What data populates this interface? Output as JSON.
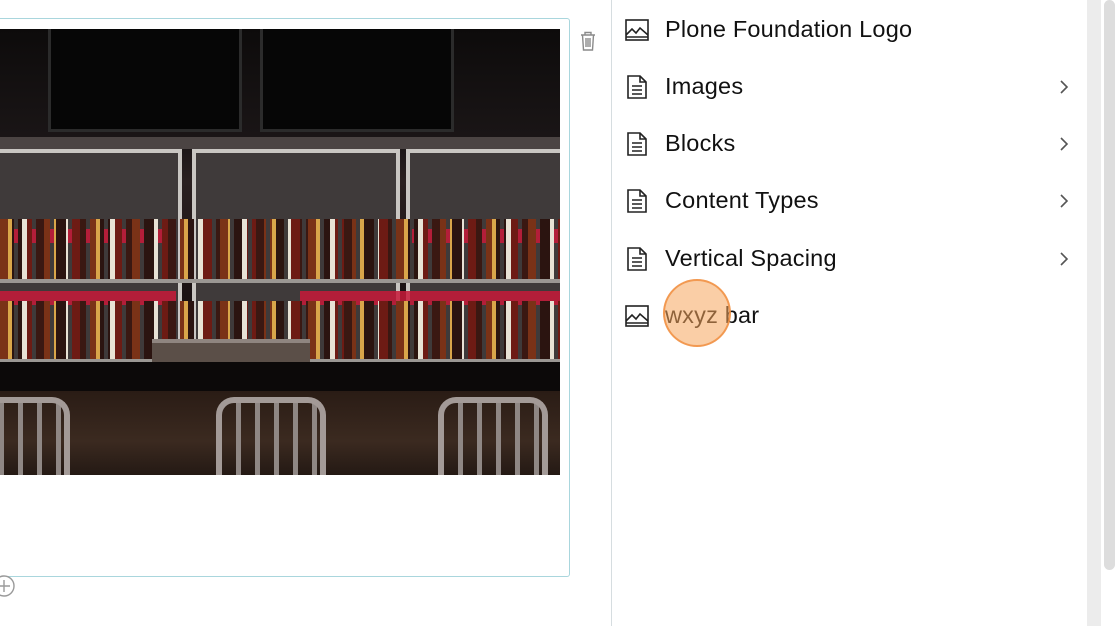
{
  "editor": {
    "image_alt": "Bar interior with shelves of liquor bottles, red backlighting and metal bar stools",
    "delete_icon": "trash-icon",
    "add_block_icon": "plus-circle-icon"
  },
  "sidebar": {
    "items": [
      {
        "label": "Plone Foundation Logo",
        "icon": "image-icon",
        "has_children": false
      },
      {
        "label": "Images",
        "icon": "document-icon",
        "has_children": true
      },
      {
        "label": "Blocks",
        "icon": "document-icon",
        "has_children": true
      },
      {
        "label": "Content Types",
        "icon": "document-icon",
        "has_children": true
      },
      {
        "label": "Vertical Spacing",
        "icon": "document-icon",
        "has_children": true
      },
      {
        "label": "wxyz bar",
        "icon": "image-icon",
        "has_children": false
      }
    ]
  },
  "colors": {
    "block_border": "#a9d6dd",
    "sidebar_border": "#d6dde0",
    "click_indicator": "#f6a55c"
  }
}
